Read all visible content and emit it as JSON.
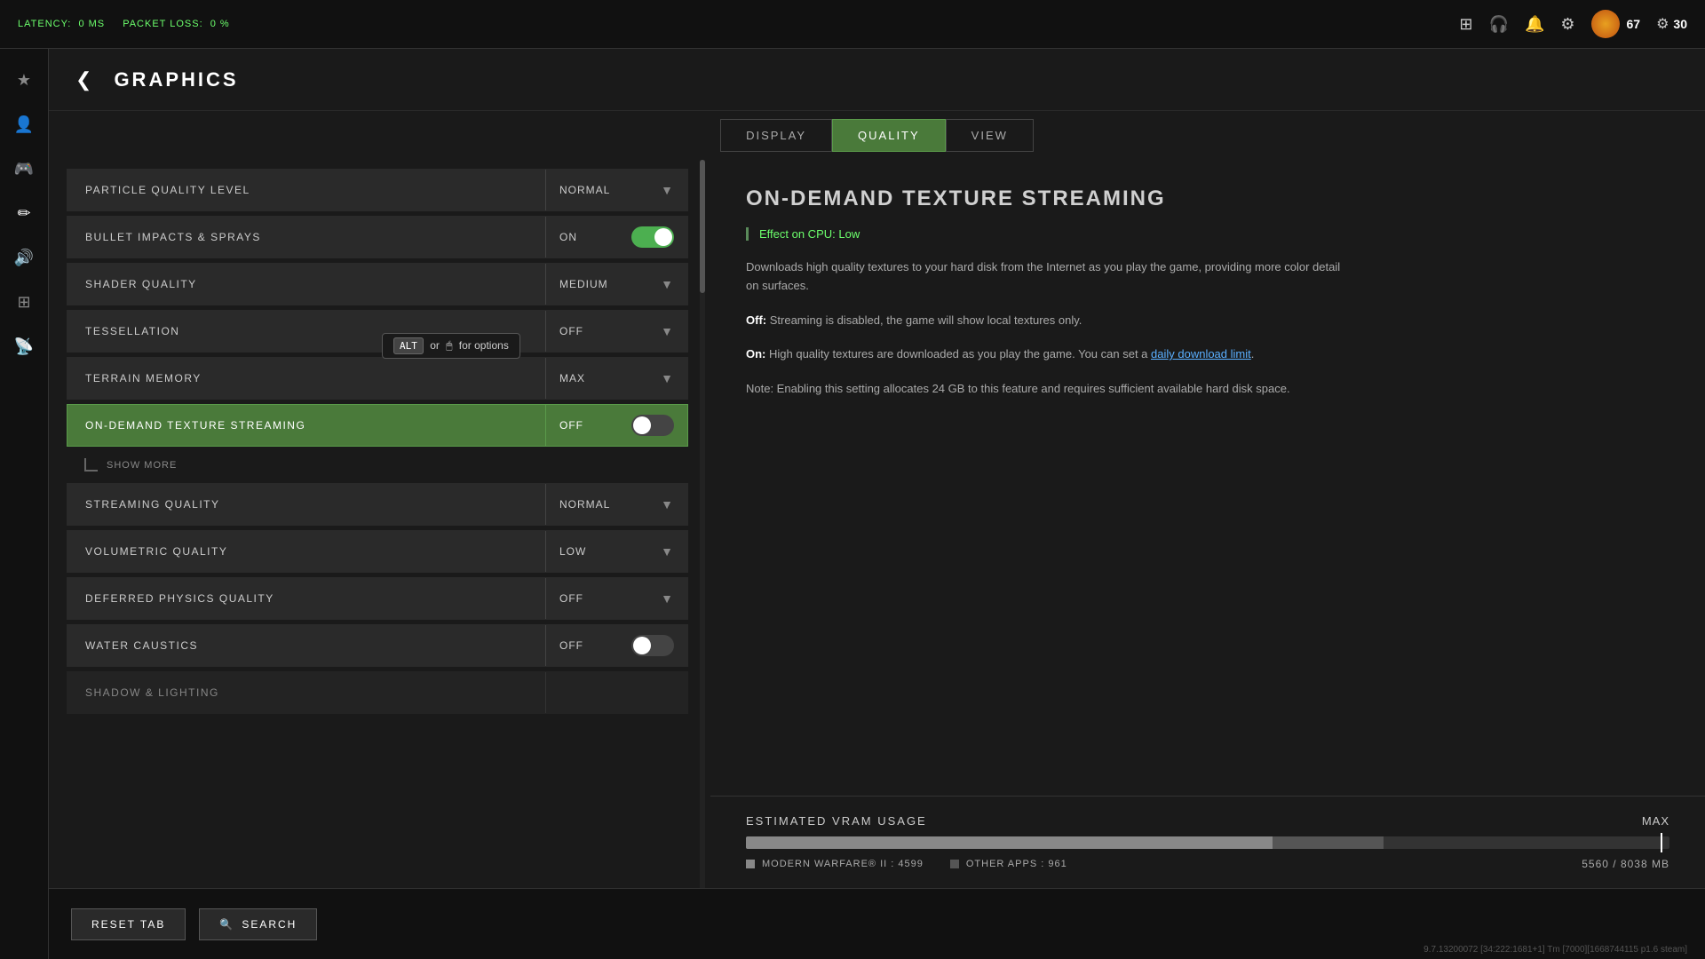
{
  "topbar": {
    "latency_label": "LATENCY:",
    "latency_value": "0 MS",
    "packet_loss_label": "PACKET LOSS:",
    "packet_loss_value": "0 %",
    "user_credits": "67",
    "cp_credits": "30"
  },
  "page": {
    "title": "GRAPHICS",
    "back_icon": "❮"
  },
  "tabs": [
    {
      "id": "display",
      "label": "DISPLAY",
      "active": false
    },
    {
      "id": "quality",
      "label": "QUALITY",
      "active": true
    },
    {
      "id": "view",
      "label": "VIEW",
      "active": false
    }
  ],
  "settings": [
    {
      "id": "particle-quality-level",
      "label": "PARTICLE QUALITY LEVEL",
      "value": "NORMAL",
      "type": "dropdown",
      "selected": false
    },
    {
      "id": "bullet-impacts-sprays",
      "label": "BULLET IMPACTS & SPRAYS",
      "value": "ON",
      "type": "toggle",
      "toggle_on": true,
      "selected": false
    },
    {
      "id": "shader-quality",
      "label": "SHADER QUALITY",
      "value": "MEDIUM",
      "type": "dropdown",
      "selected": false
    },
    {
      "id": "tessellation",
      "label": "TESSELLATION",
      "value": "OFF",
      "type": "dropdown",
      "selected": false
    },
    {
      "id": "terrain-memory",
      "label": "TERRAIN MEMORY",
      "value": "MAX",
      "type": "dropdown",
      "selected": false
    },
    {
      "id": "on-demand-texture-streaming",
      "label": "ON-DEMAND TEXTURE STREAMING",
      "value": "OFF",
      "type": "toggle",
      "toggle_on": false,
      "selected": true
    },
    {
      "id": "show-more",
      "label": "SHOW MORE",
      "type": "submenu",
      "selected": false
    },
    {
      "id": "streaming-quality",
      "label": "STREAMING QUALITY",
      "value": "NORMAL",
      "type": "dropdown",
      "selected": false
    },
    {
      "id": "volumetric-quality",
      "label": "VOLUMETRIC QUALITY",
      "value": "LOW",
      "type": "dropdown",
      "selected": false
    },
    {
      "id": "deferred-physics-quality",
      "label": "DEFERRED PHYSICS QUALITY",
      "value": "OFF",
      "type": "dropdown",
      "selected": false
    },
    {
      "id": "water-caustics",
      "label": "WATER CAUSTICS",
      "value": "OFF",
      "type": "toggle",
      "toggle_on": false,
      "selected": false
    },
    {
      "id": "shadow-lighting",
      "label": "SHADOW & LIGHTING",
      "value": "",
      "type": "header",
      "selected": false
    }
  ],
  "tooltip": {
    "alt_label": "ALT",
    "or_text": "or",
    "mouse_icon": "🖱",
    "suffix": "for options"
  },
  "detail": {
    "title": "ON-DEMAND TEXTURE STREAMING",
    "cpu_effect_label": "Effect on CPU:",
    "cpu_effect_value": "Low",
    "paragraphs": [
      "Downloads high quality textures to your hard disk from the Internet as you play the game, providing more color detail on surfaces.",
      "Off: Streaming is disabled, the game will show local textures only.",
      "On: High quality textures are downloaded as you play the game. You can set a daily download limit.",
      "Note: Enabling this setting allocates 24 GB to this feature and requires sufficient available hard disk space."
    ],
    "off_label": "Off",
    "on_label": "On",
    "download_link": "daily download limit"
  },
  "vram": {
    "label": "ESTIMATED VRAM USAGE",
    "max_label": "MAX",
    "mw_label": "MODERN WARFARE® II",
    "mw_value": "4599",
    "other_label": "OTHER APPS",
    "other_value": "961",
    "used": "5560",
    "total": "8038",
    "unit": "MB",
    "mw_percent": 57,
    "other_percent": 12,
    "marker_percent": 69
  },
  "buttons": {
    "reset_tab": "RESET TAB",
    "search": "SEARCH",
    "search_icon": "🔍"
  },
  "version": "9.7.13200072 [34:222:1681+1] Tm [7000][1668744115 p1.6 steam]",
  "sidebar": {
    "icons": [
      {
        "id": "favorites",
        "symbol": "★",
        "active": false
      },
      {
        "id": "player",
        "symbol": "👤",
        "active": false
      },
      {
        "id": "controller",
        "symbol": "🎮",
        "active": false
      },
      {
        "id": "pencil",
        "symbol": "✏",
        "active": true
      },
      {
        "id": "audio",
        "symbol": "🔊",
        "active": false
      },
      {
        "id": "display2",
        "symbol": "⊞",
        "active": false
      },
      {
        "id": "network",
        "symbol": "📡",
        "active": false
      }
    ]
  }
}
